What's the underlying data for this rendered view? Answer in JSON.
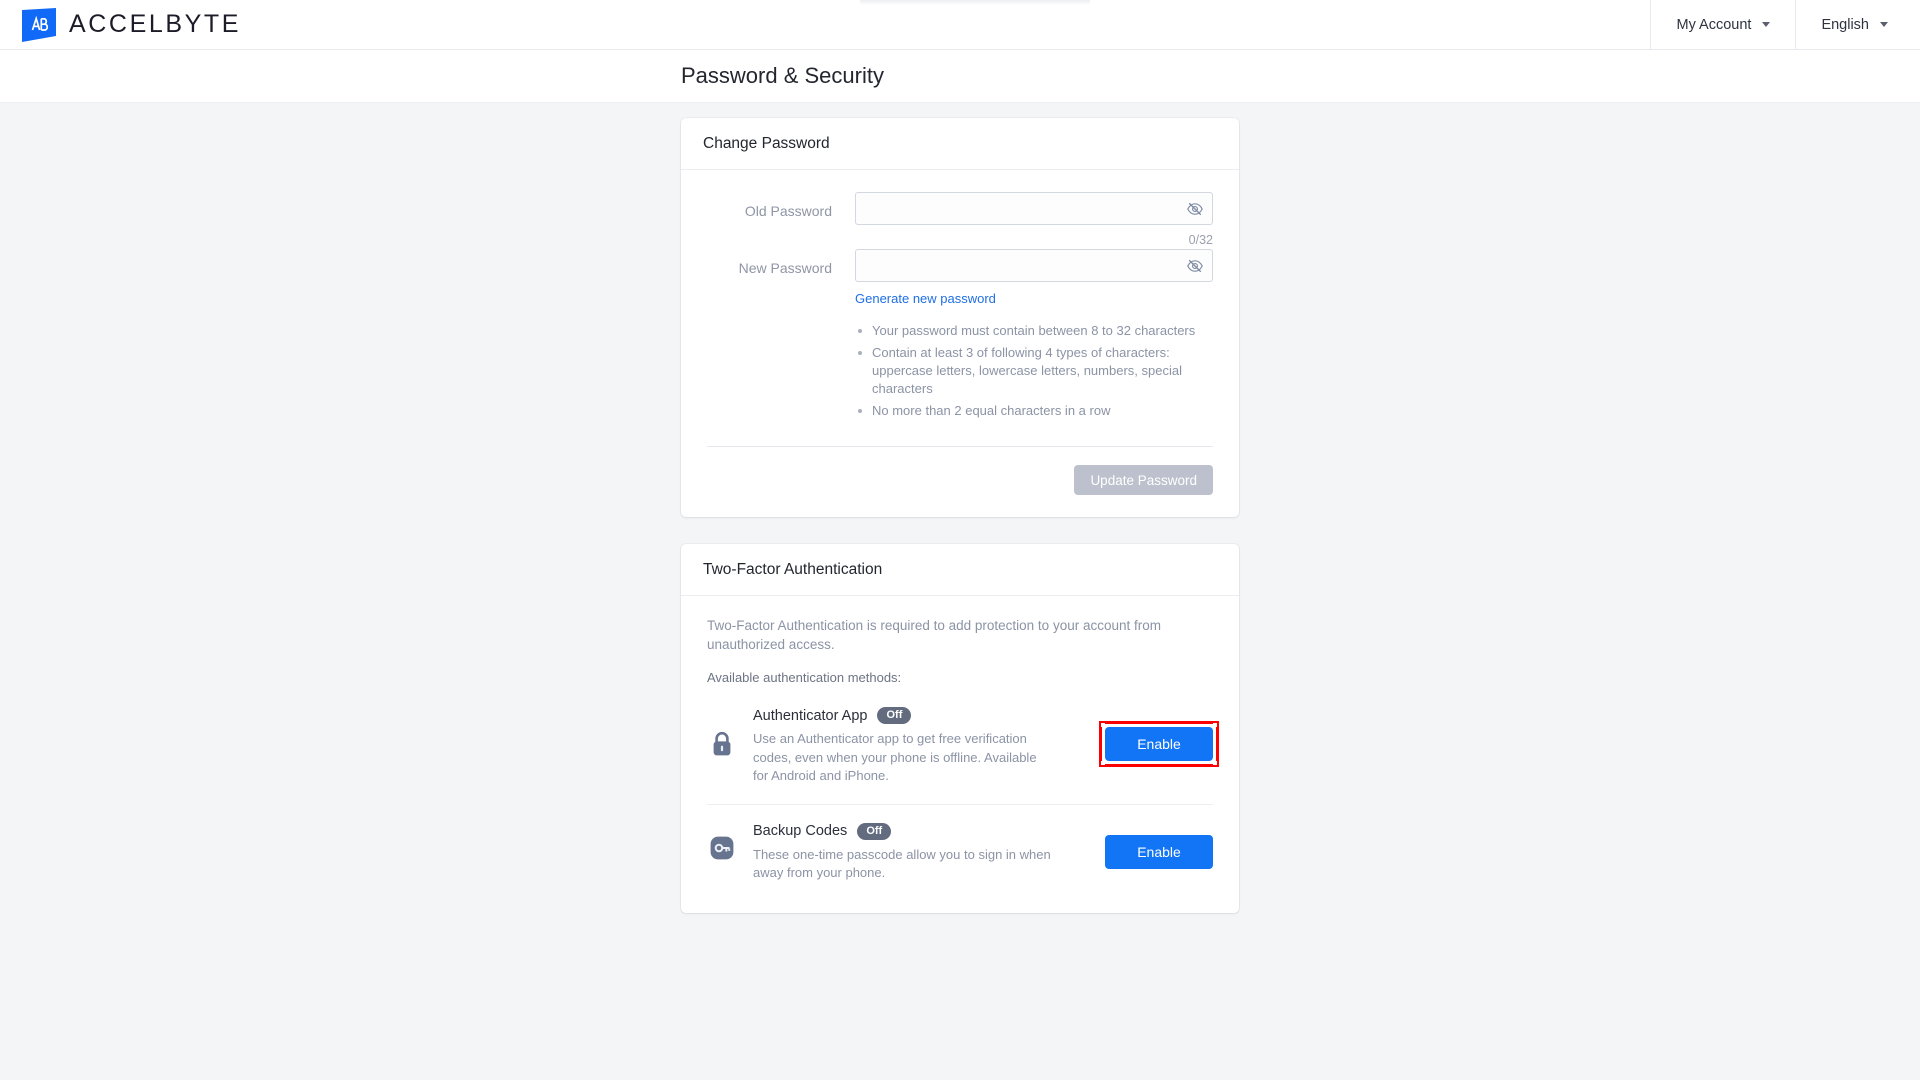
{
  "brand": {
    "name": "ACCELBYTE",
    "mark_initials": "AB",
    "mark_color": "#1169f7"
  },
  "topnav": {
    "account_label": "My Account",
    "language_label": "English"
  },
  "header": {
    "title": "Password & Security"
  },
  "change_password": {
    "card_title": "Change Password",
    "old_password": {
      "label": "Old Password",
      "value": "",
      "placeholder": ""
    },
    "new_password": {
      "label": "New Password",
      "value": "",
      "placeholder": "",
      "counter": "0/32",
      "generate_link": "Generate new password"
    },
    "rules": [
      "Your password must contain between 8 to 32 characters",
      "Contain at least 3 of following 4 types of characters: uppercase letters, lowercase letters, numbers, special characters",
      "No more than 2 equal characters in a row"
    ],
    "submit_label": "Update Password",
    "submit_enabled": false
  },
  "two_factor": {
    "card_title": "Two-Factor Authentication",
    "description": "Two-Factor Authentication is required to add protection to your account from unauthorized access.",
    "methods_label": "Available authentication methods:",
    "methods": [
      {
        "icon": "lock-icon",
        "title": "Authenticator App",
        "status": "Off",
        "description": "Use an Authenticator app to get free verification codes, even when your phone is offline. Available for Android and iPhone.",
        "action_label": "Enable",
        "highlighted": true
      },
      {
        "icon": "key-icon",
        "title": "Backup Codes",
        "status": "Off",
        "description": "These one-time passcode allow you to sign in when away from your phone.",
        "action_label": "Enable",
        "highlighted": false
      }
    ]
  },
  "colors": {
    "primary": "#1275f5",
    "link": "#1f6fe5",
    "badge": "#636b7e",
    "disabled": "#bcc1cd",
    "page_bg": "#f4f5f7",
    "annotation": "#fe0000"
  }
}
